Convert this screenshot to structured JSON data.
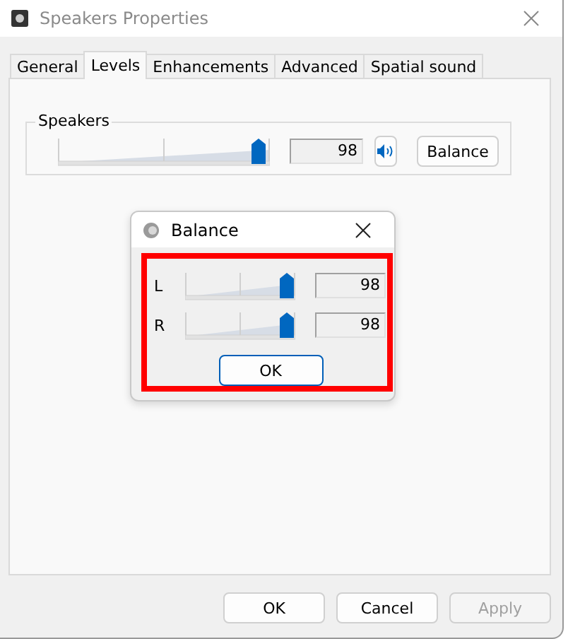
{
  "window": {
    "title": "Speakers Properties"
  },
  "tabs": [
    {
      "label": "General",
      "selected": false
    },
    {
      "label": "Levels",
      "selected": true
    },
    {
      "label": "Enhancements",
      "selected": false
    },
    {
      "label": "Advanced",
      "selected": false
    },
    {
      "label": "Spatial sound",
      "selected": false
    }
  ],
  "levels": {
    "group_title": "Speakers",
    "level": 0.98,
    "value": "98",
    "muted": false,
    "balance_button": "Balance"
  },
  "balance_dialog": {
    "title": "Balance",
    "highlighted": true,
    "channels": [
      {
        "label": "L",
        "level": 0.98,
        "value": "98"
      },
      {
        "label": "R",
        "level": 0.98,
        "value": "98"
      }
    ],
    "ok_button": "OK"
  },
  "buttons": [
    {
      "label": "OK",
      "disabled": false
    },
    {
      "label": "Cancel",
      "disabled": false
    },
    {
      "label": "Apply",
      "disabled": true
    }
  ]
}
